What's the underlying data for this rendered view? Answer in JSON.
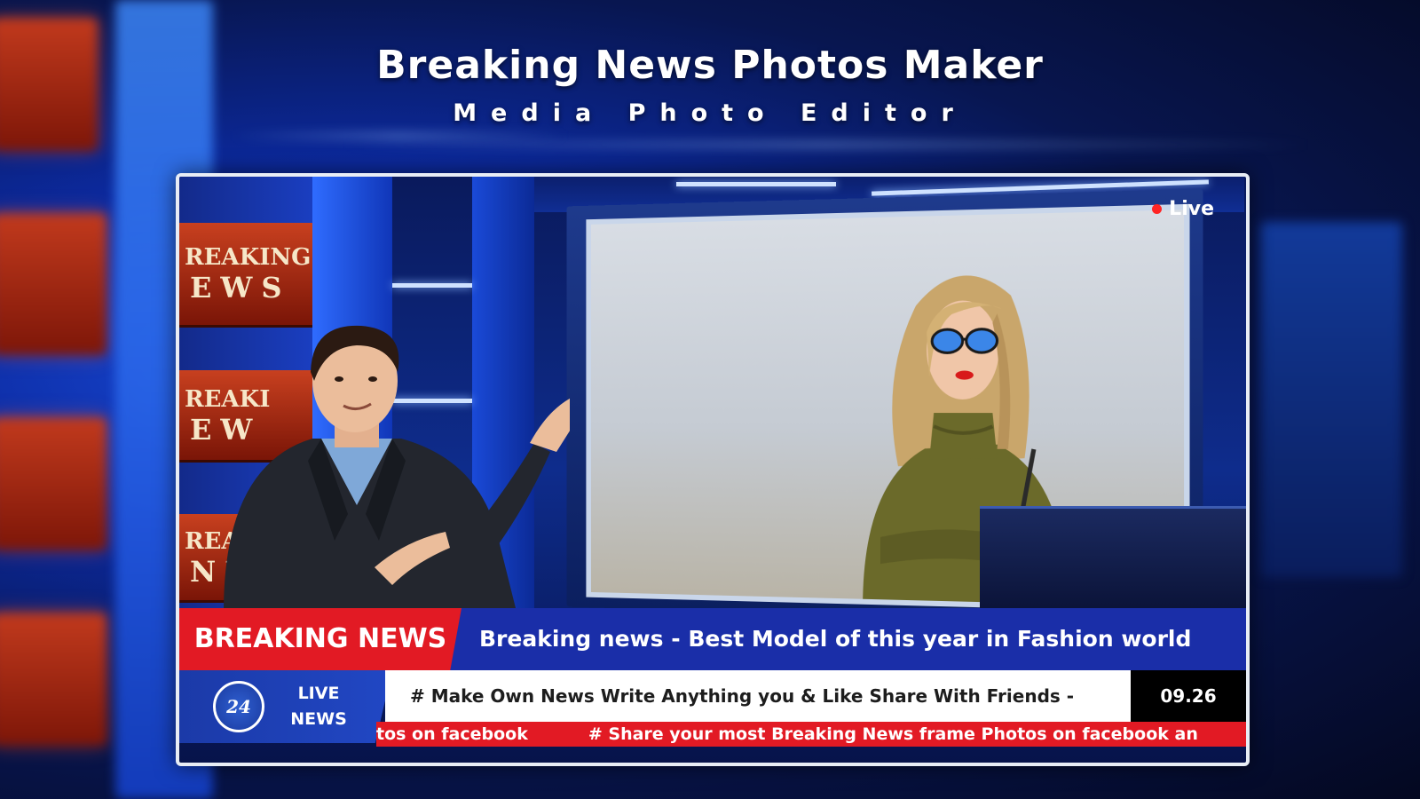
{
  "app": {
    "title": "Breaking News Photos Maker",
    "subtitle": "Media Photo Editor"
  },
  "studio": {
    "sign_lines": [
      [
        "REAKING",
        "EWS"
      ],
      [
        "REAKI",
        "EW"
      ],
      [
        "REA",
        "NE"
      ]
    ],
    "live_label": "Live"
  },
  "lower_third": {
    "breaking_label": "BREAKING NEWS",
    "headline": "Breaking news - Best Model of this year in Fashion world",
    "logo_text": "24",
    "live_news_line1": "LIVE",
    "live_news_line2": "NEWS",
    "ticker_white": "# Make Own News Write Anything you & Like Share With Friends -",
    "clock": "09.26",
    "ticker_red_head": "tos on facebook",
    "ticker_red_main": "# Share your most Breaking News frame Photos on facebook an"
  },
  "colors": {
    "breaking_red": "#e21a24",
    "headline_blue": "#1a2ea8",
    "live_dot": "#ff2424",
    "frame_border": "#e8edf5"
  },
  "icons": {
    "live_dot": "live-dot-icon",
    "channel_logo": "channel-24-logo-icon"
  }
}
